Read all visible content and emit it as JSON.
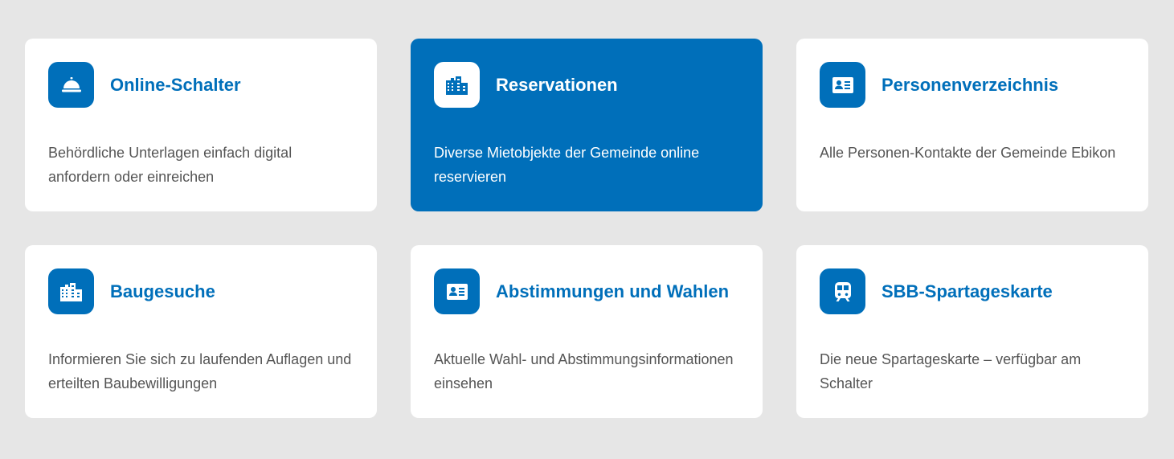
{
  "colors": {
    "page_background": "#e6e6e6",
    "card_background": "#ffffff",
    "accent": "#006fba",
    "body_text": "#555555"
  },
  "cards": [
    {
      "title": "Online-Schalter",
      "description": "Behördliche Unterlagen einfach digital anfordern oder einreichen",
      "icon": "service-bell-icon",
      "active": false
    },
    {
      "title": "Reservationen",
      "description": "Diverse Mietobjekte der Gemeinde online reservieren",
      "icon": "city-buildings-icon",
      "active": true
    },
    {
      "title": "Personenverzeichnis",
      "description": "Alle Personen-Kontakte der Gemeinde Ebikon",
      "icon": "contact-card-icon",
      "active": false
    },
    {
      "title": "Baugesuche",
      "description": "Informieren Sie sich zu laufenden Auflagen und erteilten Baubewilligungen",
      "icon": "city-buildings-icon",
      "active": false
    },
    {
      "title": "Abstimmungen und Wahlen",
      "description": "Aktuelle Wahl- und Abstimmungsinformationen einsehen",
      "icon": "contact-card-icon",
      "active": false
    },
    {
      "title": "SBB-Spartageskarte",
      "description": "Die neue Spartageskarte – verfügbar am Schalter",
      "icon": "train-icon",
      "active": false
    }
  ]
}
